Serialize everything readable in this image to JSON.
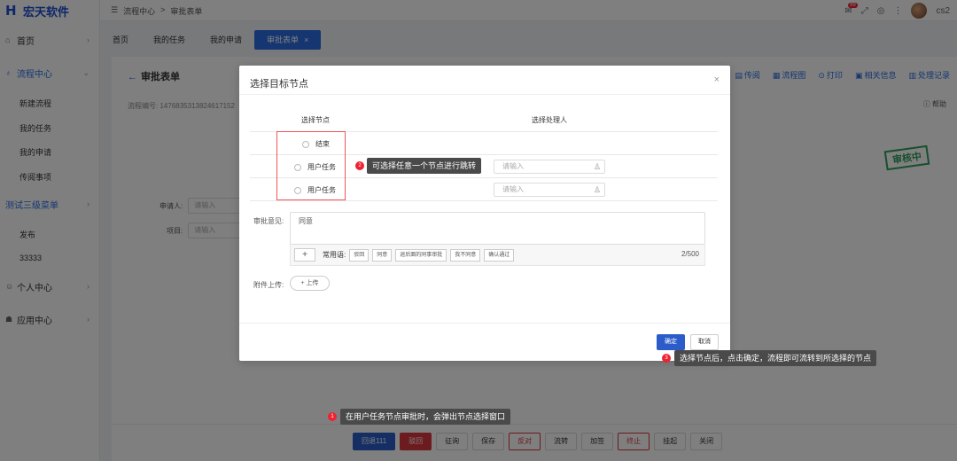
{
  "app": {
    "brand": "宏天软件",
    "user": "cs2"
  },
  "breadcrumb": [
    "流程中心",
    ">",
    "审批表单"
  ],
  "sidebar": {
    "items": [
      {
        "label": "首页"
      },
      {
        "label": "流程中心"
      },
      {
        "label": "新建流程"
      },
      {
        "label": "我的任务"
      },
      {
        "label": "我的申请"
      },
      {
        "label": "传阅事项"
      },
      {
        "label": "测试三级菜单"
      },
      {
        "label": "发布"
      },
      {
        "label": "33333"
      },
      {
        "label": "个人中心"
      },
      {
        "label": "应用中心"
      }
    ]
  },
  "topbar": {
    "notify_count": "99"
  },
  "tabs": [
    {
      "label": "首页"
    },
    {
      "label": "我的任务"
    },
    {
      "label": "我的申请"
    },
    {
      "label": "审批表单"
    }
  ],
  "page": {
    "title": "审批表单",
    "actions": [
      "传阅",
      "流程图",
      "打印",
      "相关信息",
      "处理记录"
    ],
    "process_no_label": "流程编号:",
    "process_no": "14768353138246171​52",
    "help": "帮助",
    "stamp": "审核中",
    "fields": [
      {
        "label": "申请人:",
        "placeholder": "请输入"
      },
      {
        "label": "项目:",
        "placeholder": "请输入"
      }
    ]
  },
  "bottom_buttons": [
    "回退111",
    "驳回",
    "征询",
    "保存",
    "反对",
    "流转",
    "加签",
    "终止",
    "挂起",
    "关闭"
  ],
  "modal": {
    "title": "选择目标节点",
    "col_node": "选择节点",
    "col_handler": "选择处理人",
    "rows": [
      {
        "node": "结束",
        "handler": ""
      },
      {
        "node": "用户任务",
        "handler": "请输入"
      },
      {
        "node": "用户任务",
        "handler": "请输入"
      }
    ],
    "opinion_label": "审批意见:",
    "opinion_value": "同意",
    "plus": "+",
    "phrases_label": "常用语:",
    "phrases": [
      "驳回",
      "同意",
      "退后面的同事审批",
      "我不同意",
      "确认通过"
    ],
    "count": "2/500",
    "attach_label": "附件上传:",
    "upload": "+ 上传",
    "ok": "确定",
    "cancel": "取消"
  },
  "tips": [
    {
      "num": "1",
      "text": "在用户任务节点审批时，会弹出节点选择窗口"
    },
    {
      "num": "2",
      "text": "可选择任意一个节点进行跳转"
    },
    {
      "num": "3",
      "text": "选择节点后，点击确定，流程即可流转到所选择的节点"
    }
  ],
  "colors": {
    "primary": "#2b5cc9",
    "accent": "#2b6de3",
    "danger": "#d9363e",
    "stamp": "#2e9e5b"
  }
}
